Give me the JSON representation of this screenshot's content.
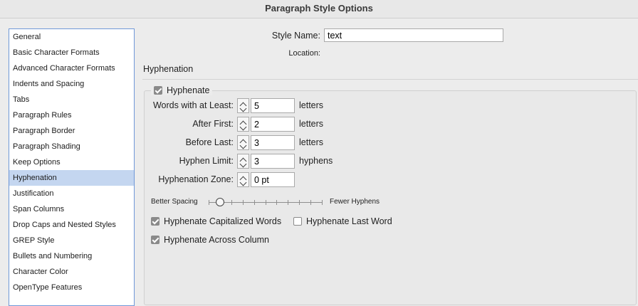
{
  "window": {
    "title": "Paragraph Style Options"
  },
  "sidebar": {
    "items": [
      {
        "label": "General"
      },
      {
        "label": "Basic Character Formats"
      },
      {
        "label": "Advanced Character Formats"
      },
      {
        "label": "Indents and Spacing"
      },
      {
        "label": "Tabs"
      },
      {
        "label": "Paragraph Rules"
      },
      {
        "label": "Paragraph Border"
      },
      {
        "label": "Paragraph Shading"
      },
      {
        "label": "Keep Options"
      },
      {
        "label": "Hyphenation",
        "selected": true
      },
      {
        "label": "Justification"
      },
      {
        "label": "Span Columns"
      },
      {
        "label": "Drop Caps and Nested Styles"
      },
      {
        "label": "GREP Style"
      },
      {
        "label": "Bullets and Numbering"
      },
      {
        "label": "Character Color"
      },
      {
        "label": "OpenType Features"
      }
    ]
  },
  "header": {
    "style_name_label": "Style Name:",
    "style_name_value": "text",
    "location_label": "Location:"
  },
  "section": {
    "title": "Hyphenation"
  },
  "hyphenate": {
    "label": "Hyphenate",
    "checked": true
  },
  "fields": {
    "words_at_least": {
      "label": "Words with at Least:",
      "value": "5",
      "unit": "letters"
    },
    "after_first": {
      "label": "After First:",
      "value": "2",
      "unit": "letters"
    },
    "before_last": {
      "label": "Before Last:",
      "value": "3",
      "unit": "letters"
    },
    "hyphen_limit": {
      "label": "Hyphen Limit:",
      "value": "3",
      "unit": "hyphens"
    },
    "hyphenation_zone": {
      "label": "Hyphenation Zone:",
      "value": "0 pt"
    }
  },
  "slider": {
    "left_label": "Better Spacing",
    "right_label": "Fewer Hyphens",
    "position": 0.1,
    "ticks": 11
  },
  "options": {
    "capitalized": {
      "label": "Hyphenate Capitalized Words",
      "checked": true
    },
    "last_word": {
      "label": "Hyphenate Last Word",
      "checked": false
    },
    "across_column": {
      "label": "Hyphenate Across Column",
      "checked": true
    }
  },
  "colors": {
    "selection": "#c4d6f0",
    "sidebar_border": "#6f98d8"
  }
}
